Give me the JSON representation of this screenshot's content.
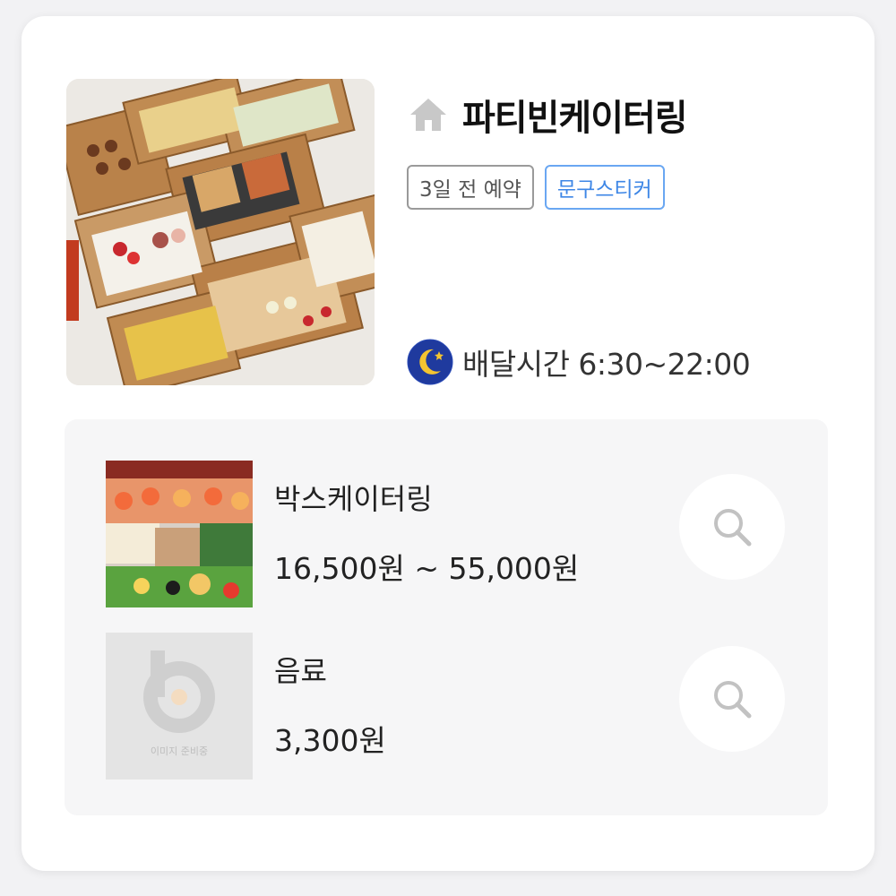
{
  "store": {
    "name": "파티빈케이터링",
    "icon": "home-icon",
    "tags": [
      {
        "label": "3일 전 예약",
        "style": "gray",
        "color": "#9a9a9a"
      },
      {
        "label": "문구스티커",
        "style": "blue",
        "color": "#3d86e6"
      }
    ],
    "delivery": {
      "icon": "moon-night-icon",
      "label": "배달시간 6:30~22:00"
    }
  },
  "menu": {
    "items": [
      {
        "name": "박스케이터링",
        "price": "16,500원 ~ 55,000원",
        "action_icon": "search-icon"
      },
      {
        "name": "음료",
        "price": "3,300원",
        "action_icon": "search-icon",
        "placeholder_text": "이미지 준비중"
      }
    ]
  },
  "colors": {
    "card_background": "#ffffff",
    "panel_background": "#f6f6f7",
    "accent_blue": "#3d86e6",
    "icon_gray": "#c8c8c8"
  }
}
